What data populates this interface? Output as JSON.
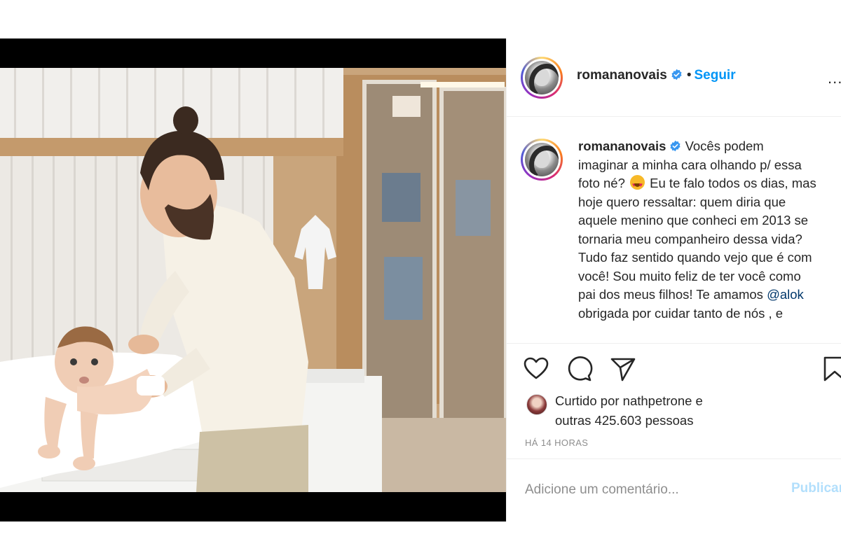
{
  "post": {
    "username": "romananovais",
    "follow_label": "Seguir",
    "separator": "•",
    "more_label": "...",
    "caption": {
      "username": "romananovais",
      "text_before_emoji": "Vocês podem imaginar a minha cara olhando p/ essa foto né?",
      "text_after_emoji": "Eu te falo todos os dias, mas hoje quero ressaltar: quem diria que aquele menino que conheci em 2013 se tornaria meu companheiro dessa vida? Tudo faz sentido quando vejo que é com você! Sou muito feliz de ter você como pai dos meus filhos! Te amamos",
      "mention": "@alok",
      "text_after_mention": "obrigada por cuidar tanto de nós , e"
    },
    "likes": {
      "text": "Curtido por nathpetrone e",
      "text_line2": "outras 425.603 pessoas"
    },
    "timestamp": "HÁ 14 HORAS",
    "comment": {
      "placeholder": "Adicione um comentário...",
      "publish_label": "Publicar"
    }
  },
  "icons": {
    "like": "heart-icon",
    "comment": "comment-icon",
    "share": "send-icon",
    "save": "bookmark-icon",
    "verified": "verified-badge-icon"
  },
  "colors": {
    "accent": "#0095f6",
    "publish_disabled": "#b2dffc",
    "text": "#262626",
    "secondary": "#8e8e8e"
  }
}
